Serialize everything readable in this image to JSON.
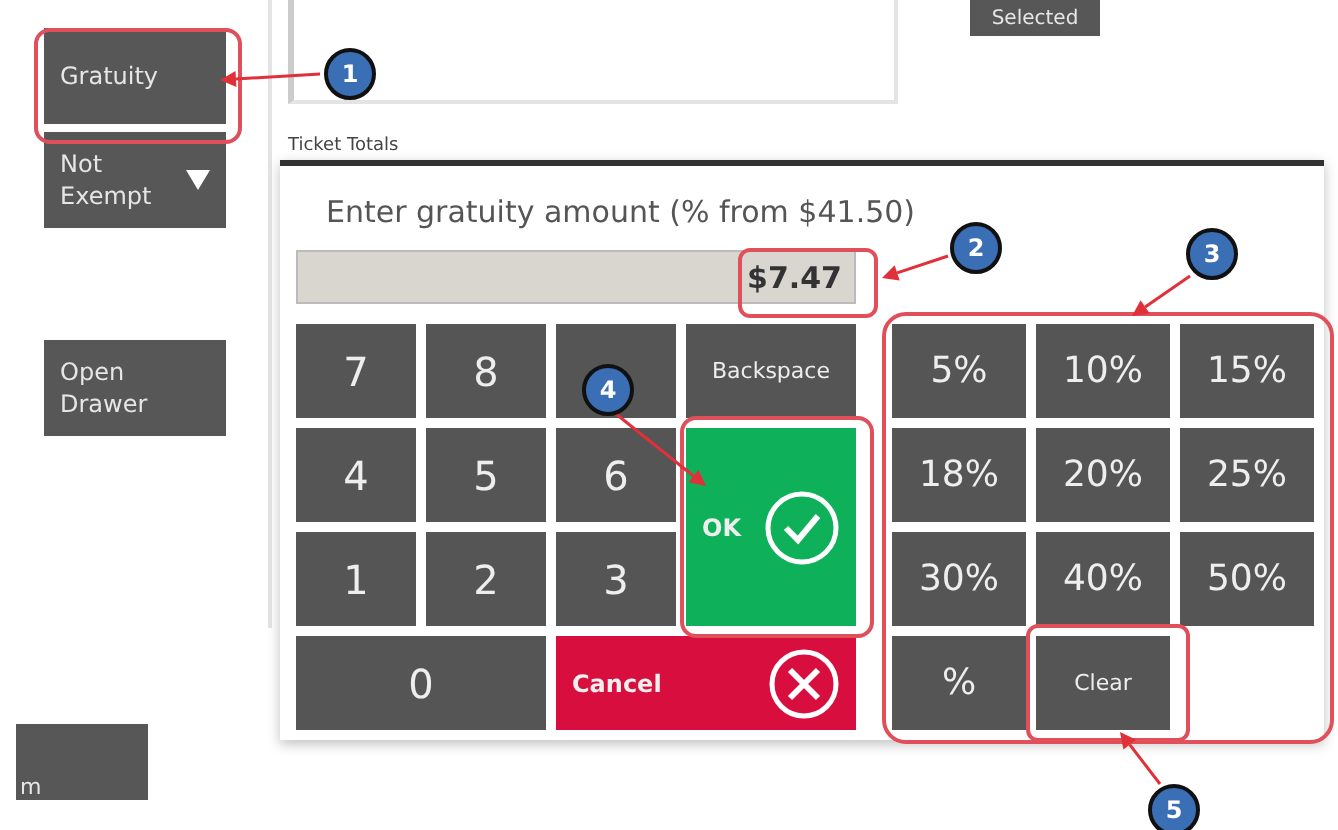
{
  "background": {
    "side_buttons": [
      {
        "label": "Gratuity",
        "kind": "plain"
      },
      {
        "label": "Not Exempt",
        "kind": "dropdown"
      },
      {
        "label": "Open Drawer",
        "kind": "plain"
      }
    ],
    "top_button": "Selected",
    "section_label": "Ticket Totals",
    "bottom_left_button": "m"
  },
  "dialog": {
    "prompt": "Enter gratuity amount (% from $41.50)",
    "amount": "$7.47",
    "keypad": [
      {
        "label": "7",
        "kind": "digit"
      },
      {
        "label": "8",
        "kind": "digit"
      },
      {
        "kind": "digit"
      },
      {
        "label": "Backspace",
        "kind": "backspace"
      },
      {
        "label": "4",
        "kind": "digit"
      },
      {
        "label": "5",
        "kind": "digit"
      },
      {
        "label": "6",
        "kind": "digit"
      },
      {
        "label": "OK",
        "kind": "ok"
      },
      {
        "label": "1",
        "kind": "digit"
      },
      {
        "label": "2",
        "kind": "digit"
      },
      {
        "label": "3",
        "kind": "digit"
      },
      {
        "label": "0",
        "kind": "zero"
      },
      {
        "label": "Cancel",
        "kind": "cancel"
      }
    ],
    "percent_keys": [
      {
        "label": "5%",
        "kind": "preset"
      },
      {
        "label": "10%",
        "kind": "preset"
      },
      {
        "label": "15%",
        "kind": "preset"
      },
      {
        "label": "18%",
        "kind": "preset"
      },
      {
        "label": "20%",
        "kind": "preset"
      },
      {
        "label": "25%",
        "kind": "preset"
      },
      {
        "label": "30%",
        "kind": "preset"
      },
      {
        "label": "40%",
        "kind": "preset"
      },
      {
        "label": "50%",
        "kind": "preset"
      },
      {
        "label": "%",
        "kind": "preset"
      },
      {
        "label": "Clear",
        "kind": "clear"
      }
    ]
  },
  "callouts": [
    {
      "number": "1"
    },
    {
      "number": "2"
    },
    {
      "number": "3"
    },
    {
      "number": "4"
    },
    {
      "number": "5"
    }
  ]
}
